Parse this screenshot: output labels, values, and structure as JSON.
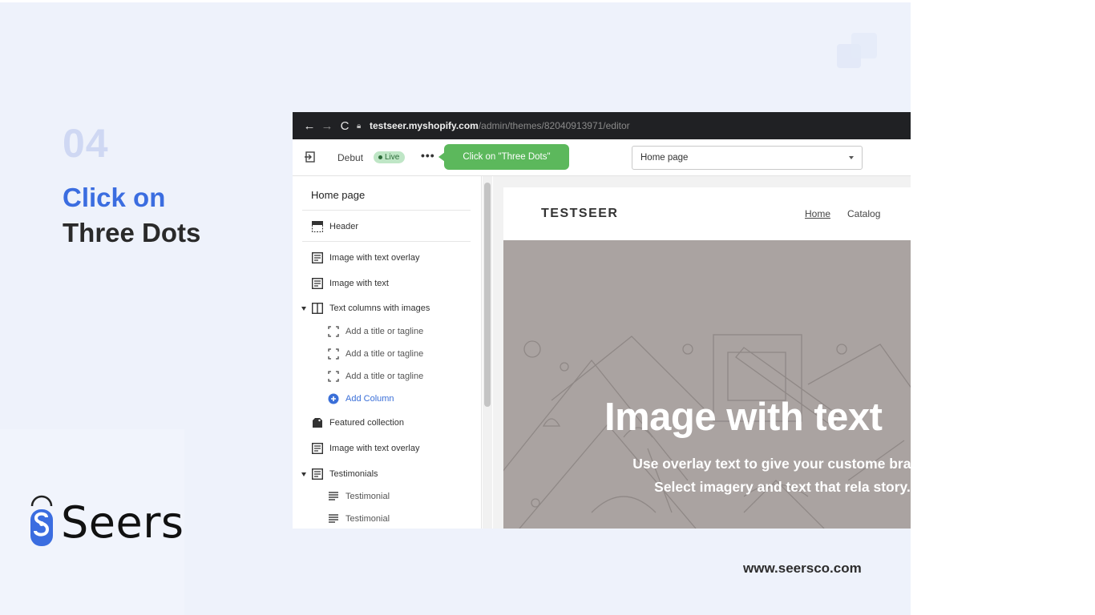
{
  "slide": {
    "step_number": "04",
    "title_line1": "Click on",
    "title_line2": "Three Dots",
    "logo_text": "Seers",
    "website": "www.seersco.com"
  },
  "browser": {
    "url_host": "testseer.myshopify.com",
    "url_path": "/admin/themes/82040913971/editor"
  },
  "editor": {
    "theme_name": "Debut",
    "live_badge": "Live",
    "three_dots": "•••",
    "callout": "Click on \"Three Dots\"",
    "page_select_value": "Home page"
  },
  "sidebar": {
    "title": "Home page",
    "header_label": "Header",
    "items": [
      {
        "label": "Image with text overlay",
        "icon": "section-icon"
      },
      {
        "label": "Image with text",
        "icon": "section-icon"
      },
      {
        "label": "Text columns with images",
        "icon": "columns-icon"
      },
      {
        "label": "Add a title or tagline",
        "icon": "block-icon"
      },
      {
        "label": "Add a title or tagline",
        "icon": "block-icon"
      },
      {
        "label": "Add a title or tagline",
        "icon": "block-icon"
      },
      {
        "label": "Add Column",
        "icon": "plus-circle-icon"
      },
      {
        "label": "Featured collection",
        "icon": "tag-icon"
      },
      {
        "label": "Image with text overlay",
        "icon": "section-icon"
      },
      {
        "label": "Testimonials",
        "icon": "section-icon"
      },
      {
        "label": "Testimonial",
        "icon": "text-block-icon"
      },
      {
        "label": "Testimonial",
        "icon": "text-block-icon"
      }
    ]
  },
  "preview": {
    "store_name": "TESTSEER",
    "nav_home": "Home",
    "nav_catalog": "Catalog",
    "hero_heading": "Image with text",
    "hero_text": "Use overlay text to give your custome brand. Select imagery and text that rela story."
  },
  "colors": {
    "accent_blue": "#3b6de0",
    "callout_green": "#5cb85c",
    "slide_bg": "#eef2fb"
  }
}
